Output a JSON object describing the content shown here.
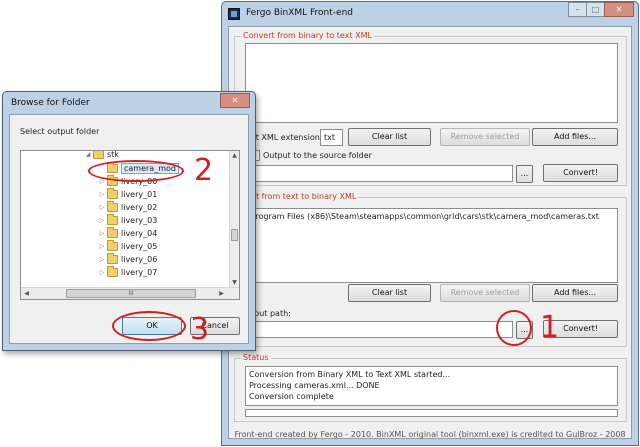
{
  "main_window": {
    "title": "Fergo BinXML Front-end",
    "window_buttons": {
      "minimize": "–",
      "maximize": "□",
      "close": "✕"
    },
    "binary_to_text": {
      "group_label": "Convert from binary to text XML",
      "extension_label": "xt XML extension:",
      "extension_value": "txt",
      "clear_list": "Clear list",
      "remove_selected": "Remove selected",
      "add_files": "Add files...",
      "output_to_source_label": "Output to the source folder",
      "browse": "...",
      "convert": "Convert!"
    },
    "text_to_binary": {
      "group_label": "vert from text to binary XML",
      "files": [
        "\\Program Files (x86)\\Steam\\steamapps\\common\\grid\\cars\\stk\\camera_mod\\cameras.txt"
      ],
      "clear_list": "Clear list",
      "remove_selected": "Remove selected",
      "add_files": "Add files...",
      "output_path_label": "tput path:",
      "browse": "...",
      "convert": "Convert!"
    },
    "status": {
      "group_label": "Status",
      "lines": [
        "Conversion from Binary XML to Text XML started...",
        "Processing cameras.xml... DONE",
        "Conversion complete"
      ]
    },
    "footer": "Front-end created by Fergo - 2010. BinXML original tool (binxml.exe) is credited to GulBroz - 2008"
  },
  "browse_dialog": {
    "title": "Browse for Folder",
    "close": "✕",
    "prompt": "Select output folder",
    "tree": {
      "parent": "stk",
      "items": [
        "camera_mod",
        "livery_00",
        "livery_01",
        "livery_02",
        "livery_03",
        "livery_04",
        "livery_05",
        "livery_06",
        "livery_07"
      ],
      "selected": "camera_mod"
    },
    "hscroll_grip": "III",
    "ok": "OK",
    "cancel": "Cancel"
  },
  "annotations": [
    "1",
    "2",
    "3"
  ],
  "colors": {
    "annotation": "#d02020",
    "group_label": "#c0392b",
    "window_frame": "#bcd0e6",
    "close_button": "#d88f83"
  }
}
